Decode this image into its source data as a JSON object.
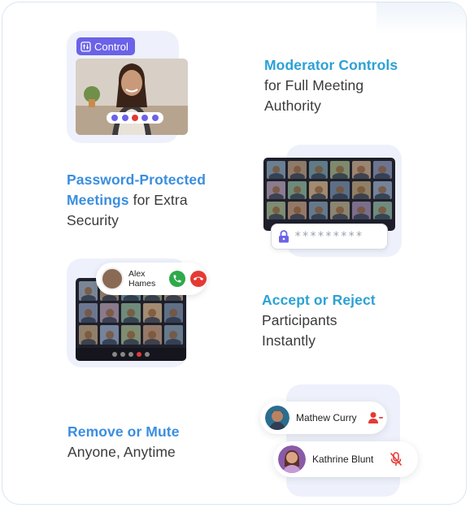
{
  "features": [
    {
      "highlight": "Moderator Controls",
      "rest_lines": [
        "for Full Meeting",
        "Authority"
      ]
    },
    {
      "highlight_lines": [
        "Password-Protected",
        "Meetings"
      ],
      "rest_inline": " for Extra",
      "rest_lines": [
        "Security"
      ]
    },
    {
      "highlight": "Accept or Reject",
      "rest_lines": [
        "Participants",
        "Instantly"
      ]
    },
    {
      "highlight": "Remove or Mute",
      "rest_lines": [
        "Anyone, Anytime"
      ]
    }
  ],
  "control_badge": {
    "label": "Control"
  },
  "password_field": {
    "value": "*********"
  },
  "incoming_call": {
    "name_line1": "Alex",
    "name_line2": "Hames"
  },
  "participants": [
    {
      "name": "Mathew Curry",
      "action_icon": "remove-user-icon"
    },
    {
      "name": "Kathrine Blunt",
      "action_icon": "mic-muted-icon"
    }
  ],
  "colors": {
    "highlight_teal": "#2ba1d6",
    "highlight_blue": "#3a8ee0",
    "panel_bg": "#eef1fb",
    "accent_purple": "#6b62e8",
    "danger_red": "#e53935",
    "accept_green": "#2eaa4a"
  }
}
